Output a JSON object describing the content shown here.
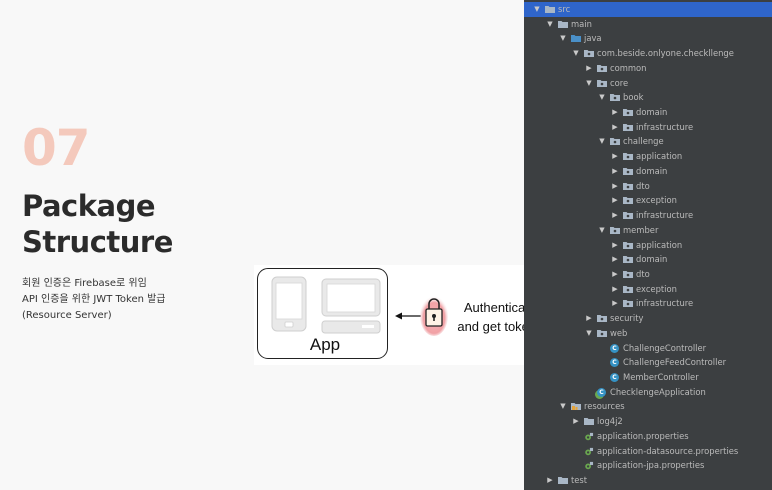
{
  "slide": {
    "number": "07",
    "title_line1": "Package",
    "title_line2": "Structure",
    "description": [
      "회원 인증은 Firebase로 위임",
      "API 인증을 위한 JWT Token 발급",
      "(Resource Server)"
    ]
  },
  "diagram": {
    "app_label": "App",
    "auth_line1": "Authenticate",
    "auth_line2": "and get tokens"
  },
  "tree": [
    {
      "label": "src",
      "depth": 0,
      "arrow": "expanded",
      "icon": "folder-icon",
      "selected": true
    },
    {
      "label": "main",
      "depth": 1,
      "arrow": "expanded",
      "icon": "folder-icon"
    },
    {
      "label": "java",
      "depth": 2,
      "arrow": "expanded",
      "icon": "source-folder-icon"
    },
    {
      "label": "com.beside.onlyone.checkllenge",
      "depth": 3,
      "arrow": "expanded",
      "icon": "package-icon"
    },
    {
      "label": "common",
      "depth": 4,
      "arrow": "collapsed",
      "icon": "package-icon"
    },
    {
      "label": "core",
      "depth": 4,
      "arrow": "expanded",
      "icon": "package-icon"
    },
    {
      "label": "book",
      "depth": 5,
      "arrow": "expanded",
      "icon": "package-icon"
    },
    {
      "label": "domain",
      "depth": 6,
      "arrow": "collapsed",
      "icon": "package-icon"
    },
    {
      "label": "infrastructure",
      "depth": 6,
      "arrow": "collapsed",
      "icon": "package-icon"
    },
    {
      "label": "challenge",
      "depth": 5,
      "arrow": "expanded",
      "icon": "package-icon"
    },
    {
      "label": "application",
      "depth": 6,
      "arrow": "collapsed",
      "icon": "package-icon"
    },
    {
      "label": "domain",
      "depth": 6,
      "arrow": "collapsed",
      "icon": "package-icon"
    },
    {
      "label": "dto",
      "depth": 6,
      "arrow": "collapsed",
      "icon": "package-icon"
    },
    {
      "label": "exception",
      "depth": 6,
      "arrow": "collapsed",
      "icon": "package-icon"
    },
    {
      "label": "infrastructure",
      "depth": 6,
      "arrow": "collapsed",
      "icon": "package-icon"
    },
    {
      "label": "member",
      "depth": 5,
      "arrow": "expanded",
      "icon": "package-icon"
    },
    {
      "label": "application",
      "depth": 6,
      "arrow": "collapsed",
      "icon": "package-icon"
    },
    {
      "label": "domain",
      "depth": 6,
      "arrow": "collapsed",
      "icon": "package-icon"
    },
    {
      "label": "dto",
      "depth": 6,
      "arrow": "collapsed",
      "icon": "package-icon"
    },
    {
      "label": "exception",
      "depth": 6,
      "arrow": "collapsed",
      "icon": "package-icon"
    },
    {
      "label": "infrastructure",
      "depth": 6,
      "arrow": "collapsed",
      "icon": "package-icon"
    },
    {
      "label": "security",
      "depth": 4,
      "arrow": "collapsed",
      "icon": "package-icon"
    },
    {
      "label": "web",
      "depth": 4,
      "arrow": "expanded",
      "icon": "package-icon"
    },
    {
      "label": "ChallengeController",
      "depth": 5,
      "arrow": "none",
      "icon": "class-icon"
    },
    {
      "label": "ChallengeFeedController",
      "depth": 5,
      "arrow": "none",
      "icon": "class-icon"
    },
    {
      "label": "MemberController",
      "depth": 5,
      "arrow": "none",
      "icon": "class-icon"
    },
    {
      "label": "ChecklengeApplication",
      "depth": 4,
      "arrow": "none",
      "icon": "spring-app-icon"
    },
    {
      "label": "resources",
      "depth": 2,
      "arrow": "expanded",
      "icon": "resources-folder-icon"
    },
    {
      "label": "log4j2",
      "depth": 3,
      "arrow": "collapsed",
      "icon": "folder-icon"
    },
    {
      "label": "application.properties",
      "depth": 3,
      "arrow": "none",
      "icon": "properties-icon"
    },
    {
      "label": "application-datasource.properties",
      "depth": 3,
      "arrow": "none",
      "icon": "properties-icon"
    },
    {
      "label": "application-jpa.properties",
      "depth": 3,
      "arrow": "none",
      "icon": "properties-icon"
    },
    {
      "label": "test",
      "depth": 1,
      "arrow": "collapsed",
      "icon": "folder-icon"
    }
  ],
  "colors": {
    "accent": "#f4c9bc",
    "ide_background": "#3c3f41",
    "selection": "#2f65ca",
    "class_icon": "#3592c4",
    "lock_glow": "#f1a1a5"
  }
}
